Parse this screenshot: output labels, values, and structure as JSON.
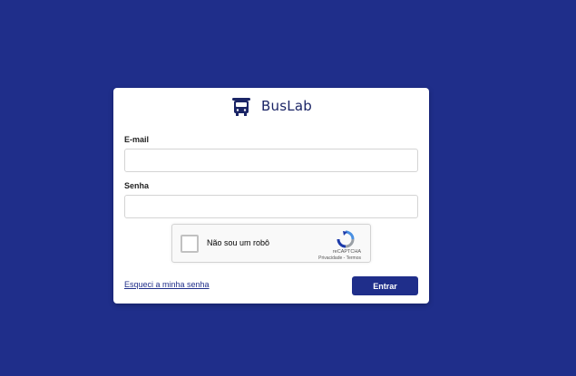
{
  "brand": {
    "name": "BusLab",
    "logo_icon": "bus-icon"
  },
  "form": {
    "email_label": "E-mail",
    "email_value": "",
    "password_label": "Senha",
    "password_value": "",
    "forgot_password_link": "Esqueci a minha senha",
    "submit_label": "Entrar"
  },
  "captcha": {
    "checkbox_label": "Não sou um robô",
    "brand": "reCAPTCHA",
    "links": "Privacidade - Termos",
    "icon": "recaptcha-icon"
  },
  "colors": {
    "background": "#1f2e8a",
    "primary": "#1f2e8a",
    "brand_text": "#1b2566"
  }
}
